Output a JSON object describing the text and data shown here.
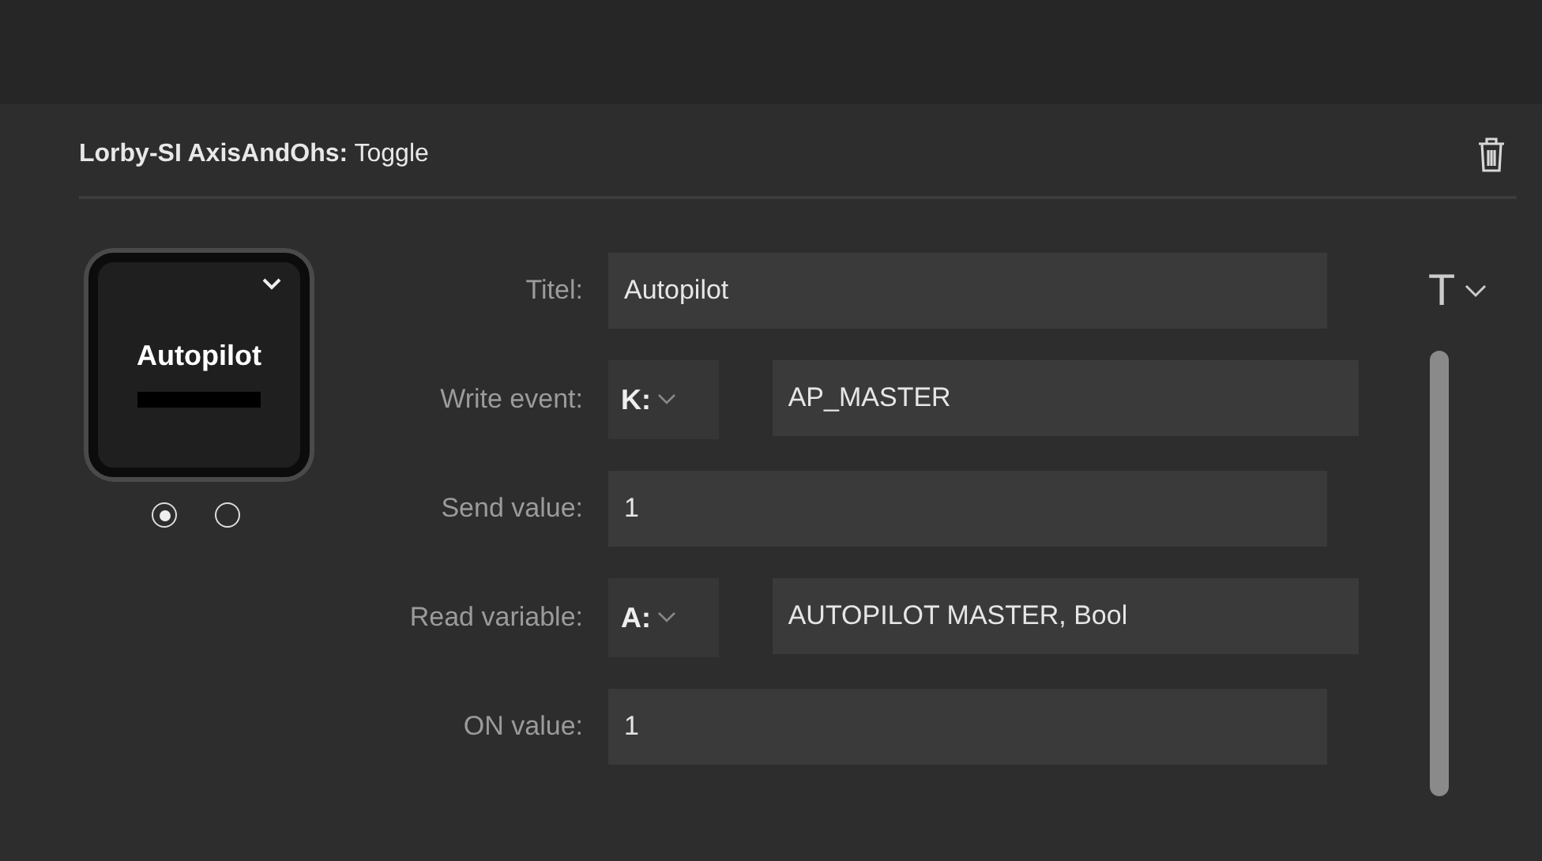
{
  "header": {
    "source": "Lorby-SI AxisAndOhs:",
    "action": "Toggle"
  },
  "key_preview": {
    "label": "Autopilot",
    "states": [
      {
        "selected": true
      },
      {
        "selected": false
      }
    ]
  },
  "form": {
    "rows": [
      {
        "kind": "text",
        "label": "Titel:",
        "value": "Autopilot"
      },
      {
        "kind": "prefixed",
        "label": "Write event:",
        "prefix": "K:",
        "value": "AP_MASTER"
      },
      {
        "kind": "text",
        "label": "Send value:",
        "value": "1"
      },
      {
        "kind": "prefixed",
        "label": "Read variable:",
        "prefix": "A:",
        "value": "AUTOPILOT MASTER, Bool"
      },
      {
        "kind": "text",
        "label": "ON value:",
        "value": "1"
      }
    ]
  },
  "title_style": {
    "letter": "T"
  }
}
